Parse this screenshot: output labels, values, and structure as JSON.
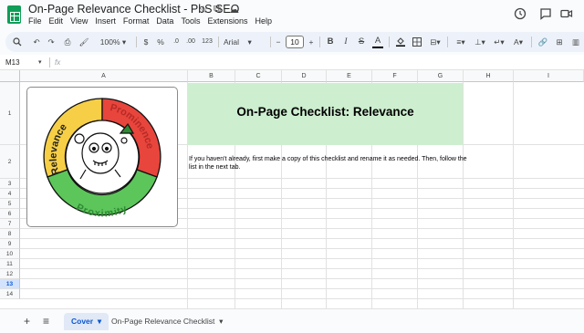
{
  "window": {
    "doc_title": "On-Page Relevance Checklist - PbS SEO"
  },
  "menu": [
    "File",
    "Edit",
    "View",
    "Insert",
    "Format",
    "Data",
    "Tools",
    "Extensions",
    "Help"
  ],
  "toolbar": {
    "zoom": "100%",
    "currency": "$",
    "percent": "%",
    "decimal_decrease": ".0",
    "decimal_increase": ".00",
    "number_format": "123",
    "font": "Arial",
    "font_size": "10",
    "minus": "−",
    "plus": "+",
    "bold": "B",
    "italic": "I",
    "strike": "S",
    "text_color": "A"
  },
  "formula_bar": {
    "cell_ref": "M13",
    "fx": "fx",
    "value": ""
  },
  "columns": [
    "A",
    "B",
    "C",
    "D",
    "E",
    "F",
    "G",
    "H",
    "I"
  ],
  "rows": [
    "1",
    "2",
    "3",
    "4",
    "5",
    "6",
    "7",
    "8",
    "9",
    "10",
    "11",
    "12",
    "13",
    "14"
  ],
  "selected_row": "13",
  "sheet": {
    "banner_title": "On-Page Checklist: Relevance",
    "note": "If you haven't already, first make a copy of this checklist and rename it as needed. Then, follow the list in the next tab.",
    "logo": {
      "relevance": "Relevance",
      "prominence": "Prominence",
      "proximity": "Proximity",
      "colors": {
        "yellow": "#f6cf46",
        "red": "#e8453c",
        "green": "#5cc65a"
      }
    }
  },
  "tabs": [
    {
      "label": "Cover",
      "active": true
    },
    {
      "label": "On-Page Relevance Checklist",
      "active": false
    }
  ],
  "colors": {
    "banner": "#cdeecf",
    "accent": "#0b57d0"
  }
}
